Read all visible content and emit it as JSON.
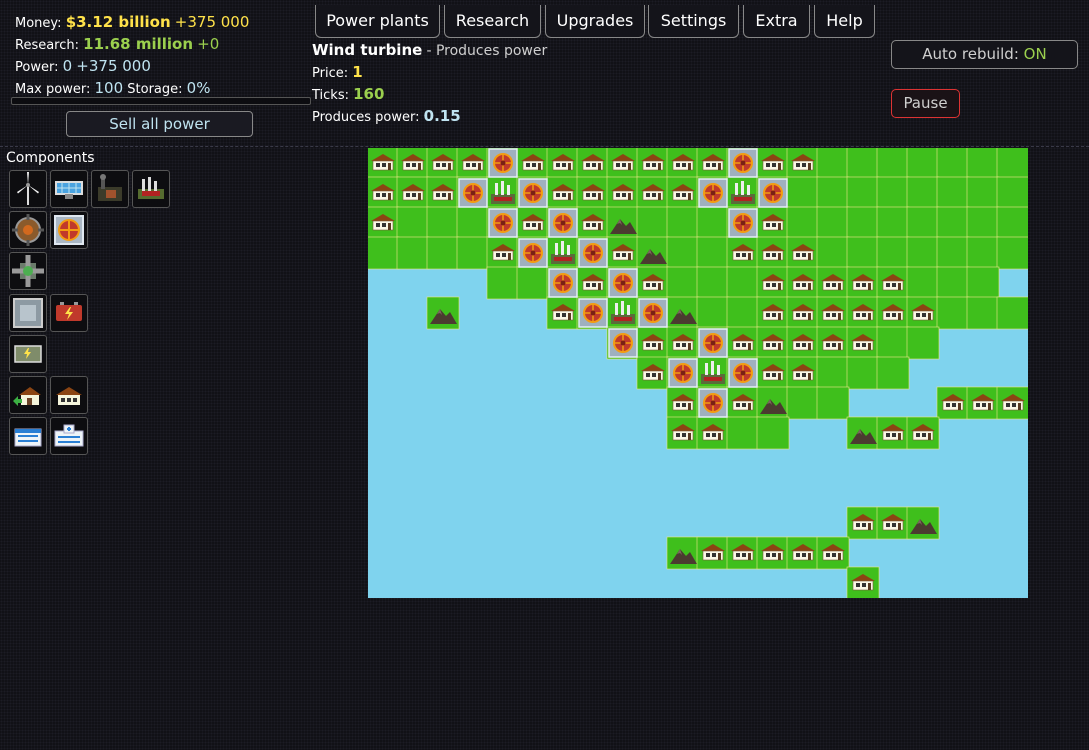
{
  "stats": {
    "money_label": "Money:",
    "money_value": "$3.12 billion",
    "money_delta": "+375 000",
    "research_label": "Research:",
    "research_value": "11.68 million",
    "research_delta": "+0",
    "power_label": "Power:",
    "power_value": "0",
    "power_delta": "+375 000",
    "maxpower_label": "Max power:",
    "maxpower_value": "100",
    "storage_label": "Storage:",
    "storage_value": "0%",
    "storage_fraction": 0
  },
  "sell_button": "Sell all power",
  "menu": [
    "Power plants",
    "Research",
    "Upgrades",
    "Settings",
    "Extra",
    "Help"
  ],
  "info": {
    "name": "Wind turbine",
    "description": "- Produces power",
    "price_label": "Price:",
    "price_value": "1",
    "ticks_label": "Ticks:",
    "ticks_value": "160",
    "produces_label": "Produces power:",
    "produces_value": "0.15"
  },
  "auto_rebuild": {
    "label": "Auto rebuild:",
    "state": "ON"
  },
  "pause_button": "Pause",
  "components": {
    "title": "Components",
    "rows": [
      [
        "wind-turbine-icon",
        "solar-panel-icon",
        "coal-plant-icon",
        "factory-icon"
      ],
      [
        "geothermal-icon",
        "nuclear-icon"
      ],
      [
        "heat-exchanger-icon"
      ],
      [
        "isolation-plate-icon",
        "battery-icon"
      ],
      [
        "power-storage-icon"
      ],
      [
        "house-upgrade-icon",
        "house-icon"
      ],
      [
        "office-building-icon",
        "hospital-icon"
      ]
    ]
  },
  "colors": {
    "water": "#7fd3ee",
    "grass": "#3fbf1c",
    "beach": "#f0e68a",
    "money": "#ffe24a",
    "research": "#9bd04e",
    "accent_blue": "#bfe3f0"
  }
}
